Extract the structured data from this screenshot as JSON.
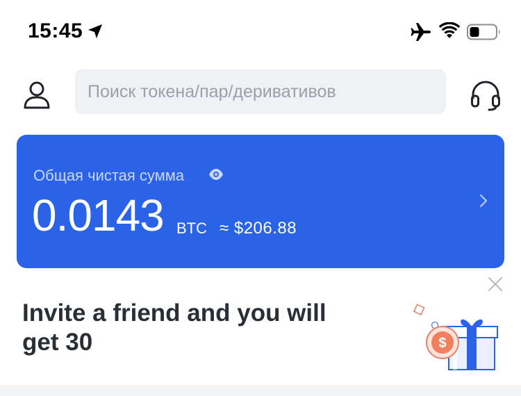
{
  "status_bar": {
    "time": "15:45",
    "icons": [
      "location-arrow-icon",
      "airplane-icon",
      "wifi-icon",
      "battery-icon"
    ]
  },
  "header": {
    "search_placeholder": "Поиск токена/пар/деривативов",
    "left_icon": "user-icon",
    "right_icon": "headset-icon"
  },
  "balance_card": {
    "label": "Общая чистая сумма",
    "amount": "0.0143",
    "unit": "BTC",
    "usd_equivalent": "≈ $206.88",
    "color": "#2b63e8"
  },
  "invite_banner": {
    "text": "Invite a friend and you will get 30",
    "icons": [
      "close-icon",
      "gift-icon",
      "dollar-coin-icon"
    ]
  }
}
